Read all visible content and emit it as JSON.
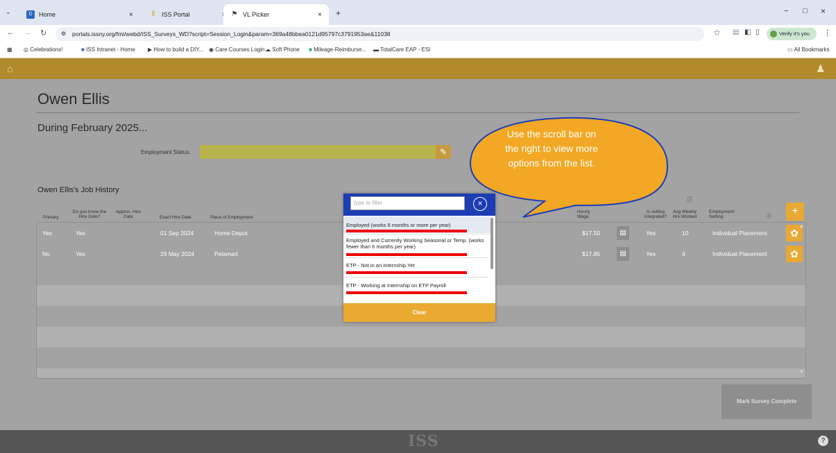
{
  "browser": {
    "tabs": [
      {
        "label": "Home",
        "close": "×"
      },
      {
        "label": "ISS Portal",
        "close": "×"
      },
      {
        "label": "VL Picker",
        "close": "×"
      }
    ],
    "new_tab": "+",
    "url": "portals.issny.org/fmi/webd/ISS_Surveys_WD?script=Session_Login&param=369a48bbea0121d95797c3791953ae&11038",
    "verify_label": "Verify it's you",
    "bookmarks": [
      "Celebrations!",
      "ISS Intranet - Home",
      "How to build a DIY...",
      "Care Courses Login",
      "Soft Phone",
      "Mileage-Reimburse...",
      "TotalCare EAP - ESI"
    ],
    "all_bookmarks": "All Bookmarks"
  },
  "page": {
    "person_name": "Owen Ellis",
    "during": "During February 2025...",
    "employment_status_label": "Employment Status:",
    "employment_status_value": "",
    "job_history_title": "Owen Ellis's Job History"
  },
  "table": {
    "headers": {
      "primary": "Primary",
      "know_hire": "Do you know the Hire Date?",
      "approx_hire": "Approx. Hire Date",
      "exact_hire": "Exact Hire Date",
      "place": "Place of Employment",
      "hourly_wage": "Hourly Wage",
      "integrated": "Is setting integrated?",
      "avg_hours": "Avg Weekly Hrs Worked",
      "setting": "Employment Setting"
    },
    "rows": [
      {
        "primary": "Yes",
        "know_hire": "Yes",
        "exact_hire": "01 Sep 2024",
        "place": "Home Depot",
        "wage": "$17.50",
        "integrated": "Yes",
        "hours": "10",
        "setting": "Individual Placement"
      },
      {
        "primary": "No",
        "know_hire": "Yes",
        "exact_hire": "29 May 2024",
        "place": "Petsmart",
        "wage": "$17.85",
        "integrated": "Yes",
        "hours": "4",
        "setting": "Individual Placement"
      }
    ]
  },
  "picker": {
    "filter_placeholder": "type to filter",
    "options": [
      "Employed (works 6 months or more per year)",
      "Employed and Currently Working Seasonal or Temp. (works fewer than 6 months per year)",
      "ETP - Not in an Internship Yet",
      "ETP - Working at Internship on ETP Payroll"
    ],
    "clear_label": "Clear"
  },
  "callout": "Use the scroll bar on the right to view more options from the list.",
  "mark_survey_label": "Mark Survey Complete",
  "footer_logo": "ISS",
  "colors": {
    "brand": "#b08a2c",
    "accent": "#e8a935",
    "picker_header": "#1d3db5",
    "highlight_line": "#e00000",
    "callout": "#f2a824"
  }
}
